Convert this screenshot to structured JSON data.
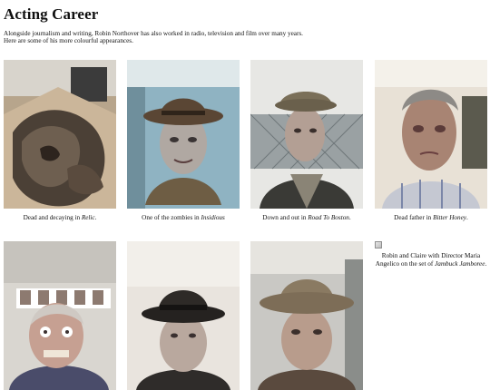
{
  "page": {
    "title": "Acting Career",
    "intro_line1": "Alongside journalism and writing, Robin Northover has also worked in radio, television and film over many years.",
    "intro_line2": "Here are some of his more colourful appearances."
  },
  "gallery": [
    {
      "caption_plain": "Dead and decaying in ",
      "caption_title": "Relic",
      "caption_after": "."
    },
    {
      "caption_plain": "One of the zombies in ",
      "caption_title": "Insidious",
      "caption_after": ""
    },
    {
      "caption_plain": "Down and out in ",
      "caption_title": "Road To Boston",
      "caption_after": "."
    },
    {
      "caption_plain": "Dead father in ",
      "caption_title": "Bitter Honey",
      "caption_after": "."
    },
    {
      "caption_plain": "",
      "caption_title": "",
      "caption_after": ""
    },
    {
      "caption_plain": "",
      "caption_title": "",
      "caption_after": ""
    },
    {
      "caption_plain": "",
      "caption_title": "",
      "caption_after": ""
    },
    {
      "caption_plain": "Robin and Claire with Director Maria Angelico on the set of ",
      "caption_title": "Jambuck Jamboree",
      "caption_after": "."
    }
  ]
}
